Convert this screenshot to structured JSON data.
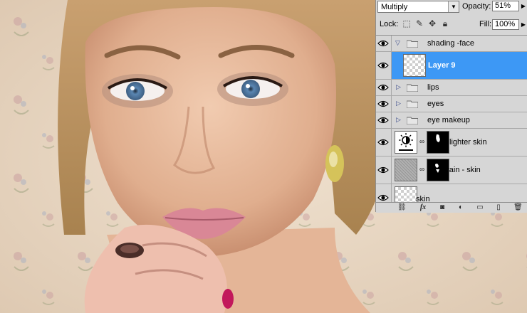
{
  "panel": {
    "blend_mode": "Multiply",
    "opacity_label": "Opacity:",
    "opacity_value": "51%",
    "lock_label": "Lock:",
    "fill_label": "Fill:",
    "fill_value": "100%",
    "selection_color": "#3d98f5"
  },
  "layers": [
    {
      "name": "shading -face",
      "type": "group",
      "expanded": true,
      "visible": true
    },
    {
      "name": "Layer 9",
      "type": "pixel",
      "selected": true,
      "visible": true
    },
    {
      "name": "lips",
      "type": "group",
      "expanded": false,
      "visible": true
    },
    {
      "name": "eyes",
      "type": "group",
      "expanded": false,
      "visible": true
    },
    {
      "name": "eye makeup",
      "type": "group",
      "expanded": false,
      "visible": true
    },
    {
      "name": "lighter skin",
      "type": "adjustment",
      "icon": "brightness-contrast-icon",
      "visible": true
    },
    {
      "name": "grain - skin",
      "type": "pixel-with-mask",
      "visible": true
    },
    {
      "name": "skin",
      "type": "pixel",
      "visible": true
    }
  ],
  "bottom_icons": [
    "link-layers-icon",
    "fx-icon",
    "add-mask-icon",
    "adjustment-layer-icon",
    "new-group-icon",
    "new-layer-icon",
    "trash-icon"
  ],
  "bottom_labels": {
    "fx": "fx"
  }
}
